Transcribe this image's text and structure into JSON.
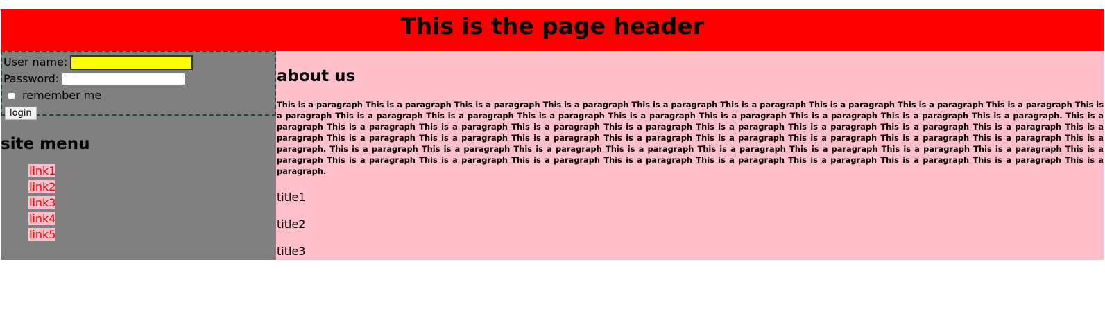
{
  "header": {
    "title": "This is the page header"
  },
  "login": {
    "username_label": "User name:",
    "username_value": "",
    "password_label": "Password:",
    "password_value": "",
    "remember_label": "remember me",
    "remember_checked": false,
    "login_button": "login"
  },
  "sidebar": {
    "menu_title": "site menu",
    "links": [
      "link1",
      "link2",
      "link3",
      "link4",
      "link5"
    ]
  },
  "content": {
    "heading": "about us",
    "paragraph": "This is a paragraph This is a paragraph This is a paragraph This is a paragraph This is a paragraph This is a paragraph This is a paragraph This is a paragraph This is a paragraph This is a paragraph This is a paragraph This is a paragraph This is a paragraph This is a paragraph This is a paragraph This is a paragraph This is a paragraph This is a paragraph. This is a paragraph This is a paragraph This is a paragraph This is a paragraph This is a paragraph This is a paragraph This is a paragraph This is a paragraph This is a paragraph This is a paragraph This is a paragraph This is a paragraph This is a paragraph This is a paragraph This is a paragraph This is a paragraph This is a paragraph This is a paragraph This is a paragraph. This is a paragraph This is a paragraph This is a paragraph This is a paragraph This is a paragraph This is a paragraph This is a paragraph This is a paragraph This is a paragraph This is a paragraph This is a paragraph This is a paragraph This is a paragraph This is a paragraph This is a paragraph This is a paragraph This is a paragraph This is a paragraph.",
    "titles": [
      "title1",
      "title2",
      "title3"
    ]
  },
  "colors": {
    "header_bg": "#ff0000",
    "sidebar_bg": "#808080",
    "content_bg": "#ffc0cb",
    "username_bg": "#ffff00",
    "link_color": "#ff0000"
  }
}
